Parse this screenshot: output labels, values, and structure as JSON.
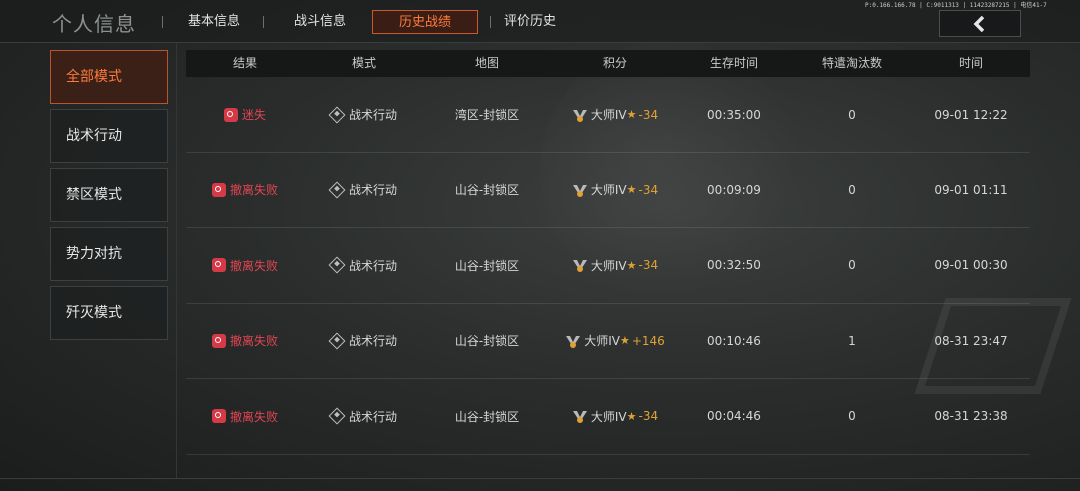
{
  "page_title": "个人信息",
  "system_info": "P:0.166.166.78 | C:9011313 | 11423287215 | 电信41-7",
  "tabs": [
    {
      "label": "基本信息",
      "active": false
    },
    {
      "label": "战斗信息",
      "active": false
    },
    {
      "label": "历史战绩",
      "active": true
    },
    {
      "label": "评价历史",
      "active": false
    }
  ],
  "back_icon": "chevron-left-icon",
  "sidebar": [
    {
      "label": "全部模式",
      "active": true
    },
    {
      "label": "战术行动",
      "active": false
    },
    {
      "label": "禁区模式",
      "active": false
    },
    {
      "label": "势力对抗",
      "active": false
    },
    {
      "label": "歼灭模式",
      "active": false
    }
  ],
  "table": {
    "headers": [
      "结果",
      "模式",
      "地图",
      "积分",
      "生存时间",
      "特遣淘汰数",
      "时间"
    ],
    "rows": [
      {
        "result": "迷失",
        "mode": "战术行动",
        "map": "湾区-封锁区",
        "rank": "大师IV",
        "delta": "-34",
        "survival": "00:35:00",
        "kills": "0",
        "time": "09-01 12:22"
      },
      {
        "result": "撤离失败",
        "mode": "战术行动",
        "map": "山谷-封锁区",
        "rank": "大师IV",
        "delta": "-34",
        "survival": "00:09:09",
        "kills": "0",
        "time": "09-01 01:11"
      },
      {
        "result": "撤离失败",
        "mode": "战术行动",
        "map": "山谷-封锁区",
        "rank": "大师IV",
        "delta": "-34",
        "survival": "00:32:50",
        "kills": "0",
        "time": "09-01 00:30"
      },
      {
        "result": "撤离失败",
        "mode": "战术行动",
        "map": "山谷-封锁区",
        "rank": "大师IV",
        "delta": "+146",
        "survival": "00:10:46",
        "kills": "1",
        "time": "08-31 23:47"
      },
      {
        "result": "撤离失败",
        "mode": "战术行动",
        "map": "山谷-封锁区",
        "rank": "大师IV",
        "delta": "-34",
        "survival": "00:04:46",
        "kills": "0",
        "time": "08-31 23:38"
      }
    ]
  },
  "colors": {
    "accent": "#ff7a3c",
    "fail": "#d63a47",
    "score": "#e0a234"
  }
}
